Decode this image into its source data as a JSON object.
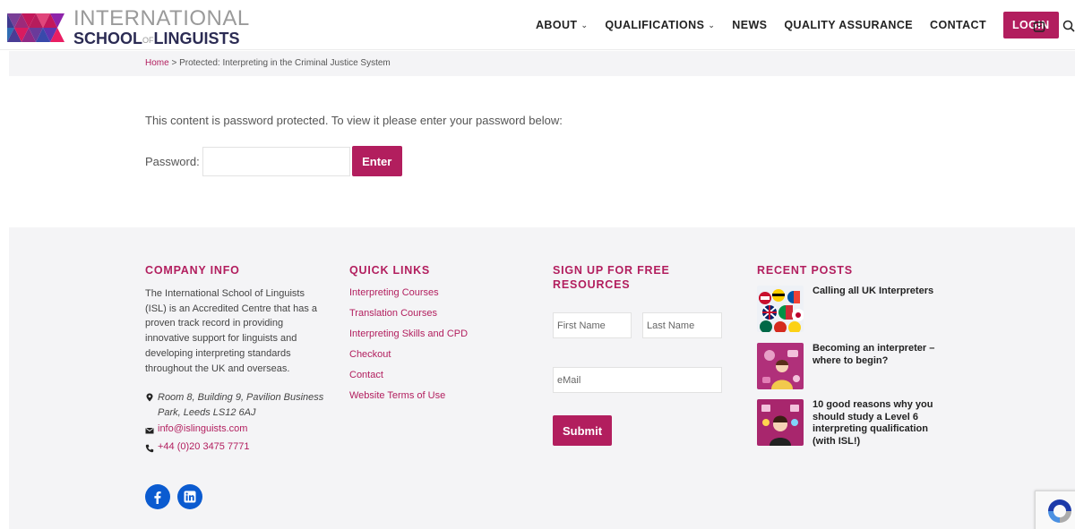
{
  "header": {
    "logo": {
      "line1": "INTERNATIONAL",
      "line2_a": "SCHOOL",
      "line2_of": "OF",
      "line2_b": "LINGUISTS"
    },
    "nav": [
      {
        "label": "ABOUT",
        "has_dropdown": true
      },
      {
        "label": "QUALIFICATIONS",
        "has_dropdown": true
      },
      {
        "label": "NEWS",
        "has_dropdown": false
      },
      {
        "label": "QUALITY ASSURANCE",
        "has_dropdown": false
      },
      {
        "label": "CONTACT",
        "has_dropdown": false
      }
    ],
    "login_label": "LOGIN",
    "icons": [
      "cart-icon",
      "search-icon"
    ]
  },
  "breadcrumb": {
    "home": "Home",
    "separator": " > ",
    "current": "Protected: Interpreting in the Criminal Justice System"
  },
  "main": {
    "message": "This content is password protected. To view it please enter your password below:",
    "password_label": "Password:",
    "password_value": "",
    "enter_label": "Enter"
  },
  "footer": {
    "company": {
      "title": "COMPANY INFO",
      "description": "The International School of Linguists (ISL) is an Accredited Centre that has a proven track record in providing innovative support for linguists and developing interpreting standards throughout the UK and overseas.",
      "address": "Room 8, Building 9, Pavilion Business Park, Leeds LS12 6AJ",
      "email": "info@islinguists.com",
      "phone": "+44 (0)20 3475 7771",
      "social": [
        "facebook-icon",
        "linkedin-icon"
      ]
    },
    "quick_links": {
      "title": "QUICK LINKS",
      "items": [
        "Interpreting Courses",
        "Translation Courses",
        "Interpreting Skills and CPD",
        "Checkout",
        "Contact",
        "Website Terms of Use"
      ]
    },
    "signup": {
      "title_line1": "SIGN UP FOR FREE",
      "title_line2": "RESOURCES",
      "first_name_placeholder": "First Name",
      "last_name_placeholder": "Last Name",
      "email_placeholder": "eMail",
      "submit_label": "Submit"
    },
    "recent_posts": {
      "title": "RECENT POSTS",
      "items": [
        {
          "title": "Calling all UK Interpreters"
        },
        {
          "title": "Becoming an interpreter – where to begin?"
        },
        {
          "title": "10 good reasons why you should study a Level 6 interpreting qualification (with ISL!)"
        }
      ]
    }
  },
  "colors": {
    "accent": "#b21e5e",
    "footer_bg": "#f4f4f6",
    "social_blue": "#0b5bd0"
  }
}
